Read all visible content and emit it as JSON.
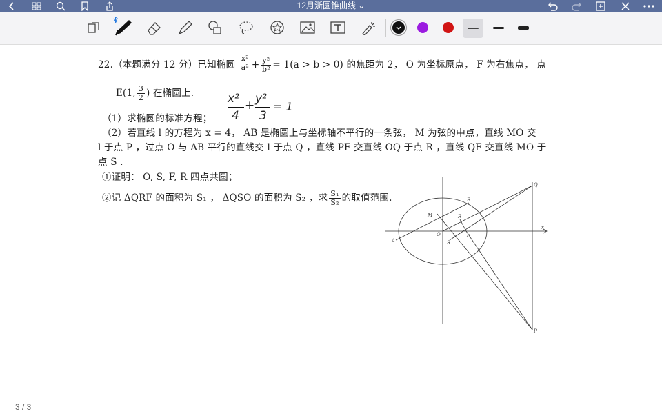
{
  "header": {
    "title": "12月浙圆锥曲线 ⌄"
  },
  "question": {
    "line1_a": "22.（本题满分 12 分）已知椭圆",
    "ellipse_num_x": "x²",
    "ellipse_den_a": "a²",
    "plus": "+",
    "ellipse_num_y": "y²",
    "ellipse_den_b": "b²",
    "line1_b": "= 1(a > b > 0) 的焦距为 2， O 为坐标原点， F 为右焦点， 点",
    "line2_a": "E(1,",
    "frac_num": "3",
    "frac_den": "2",
    "line2_b": ") 在椭圆上.",
    "part1": "（1）求椭圆的标准方程；",
    "part2_l1": "（2）若直线 l 的方程为 x = 4， AB 是椭圆上与坐标轴不平行的一条弦， M 为弦的中点，直线 MO 交",
    "part2_l2": "l 于点 P ，过点 O 与 AB 平行的直线交 l 于点 Q ，直线 PF 交直线 OQ 于点 R ，直线 QF 交直线 MO 于",
    "part2_l3": "点 S .",
    "sub1": "①证明： O, S, F, R 四点共圆；",
    "sub2_a": "②记 ΔQRF 的面积为 S₁ ， ΔQSO 的面积为 S₂ ，求",
    "s1": "S₁",
    "s2": "S₂",
    "sub2_b": "的取值范围."
  },
  "handwriting": {
    "x2": "x²",
    "four": "4",
    "plus": "+",
    "y2": "y²",
    "three": "3",
    "eq": "= 1"
  },
  "figure_labels": {
    "A": "A",
    "B": "B",
    "M": "M",
    "O": "O",
    "S": "S",
    "F": "F",
    "R": "R",
    "Q": "Q",
    "P": "P",
    "x": "x"
  },
  "footer": {
    "page": "3 / 3"
  },
  "colors": {
    "black": "#111111",
    "purple": "#9b1be0",
    "red": "#d11414"
  }
}
